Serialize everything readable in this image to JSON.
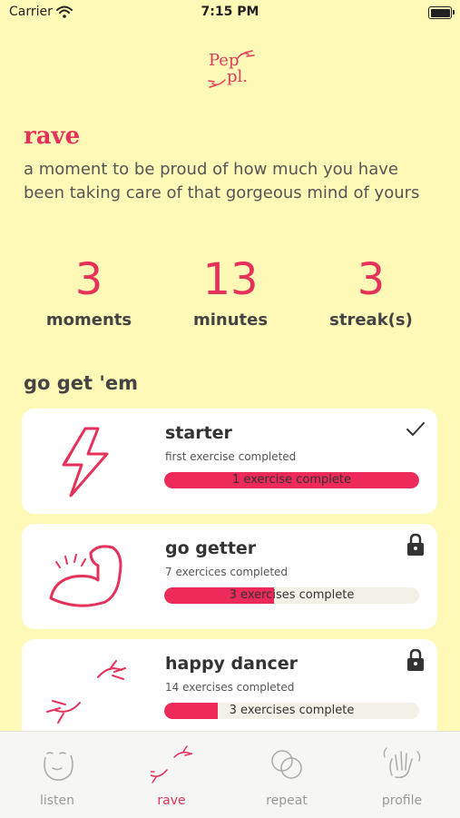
{
  "status_bar": {
    "carrier": "Carrier",
    "time": "7:15 PM"
  },
  "logo": {
    "line1": "Pep",
    "line2": "pl."
  },
  "section": {
    "title": "rave",
    "description": "a moment to be proud of how much you have been taking care of that gorgeous mind of yours"
  },
  "stats": [
    {
      "value": "3",
      "label": "moments"
    },
    {
      "value": "13",
      "label": "minutes"
    },
    {
      "value": "3",
      "label": "streak(s)"
    }
  ],
  "achievements_title": "go get 'em",
  "achievements": [
    {
      "title": "starter",
      "subtitle": "first exercise completed",
      "progress_label": "1 exercise complete",
      "progress": 1.0,
      "status": "completed",
      "art": "lightning-bolt-icon"
    },
    {
      "title": "go getter",
      "subtitle": "7 exercices completed",
      "progress_label": "3 exercises complete",
      "progress": 0.43,
      "status": "locked",
      "art": "flexed-arm-icon"
    },
    {
      "title": "happy dancer",
      "subtitle": "14 exercises completed",
      "progress_label": "3 exercises complete",
      "progress": 0.21,
      "status": "locked",
      "art": "dancing-hands-icon"
    }
  ],
  "tabs": [
    {
      "label": "listen",
      "icon": "calm-face-icon",
      "active": false
    },
    {
      "label": "rave",
      "icon": "dancing-hands-icon",
      "active": true
    },
    {
      "label": "repeat",
      "icon": "overlapping-circles-icon",
      "active": false
    },
    {
      "label": "profile",
      "icon": "waving-hand-icon",
      "active": false
    }
  ],
  "colors": {
    "background": "#fff9b8",
    "accent": "#e5325a",
    "card": "#ffffff",
    "track": "#f3f0e8",
    "tab_inactive": "#999999"
  }
}
